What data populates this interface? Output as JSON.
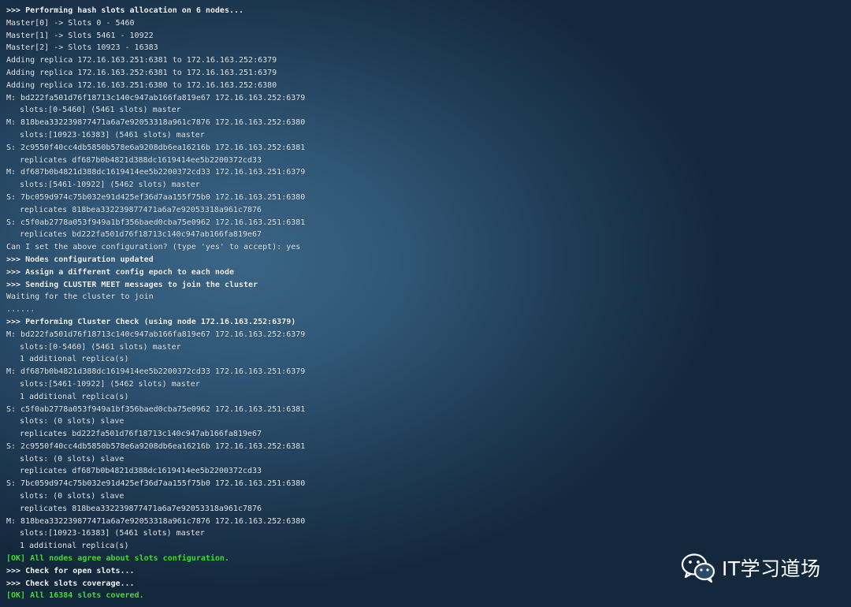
{
  "terminal": {
    "lines": [
      {
        "text": ">>> Performing hash slots allocation on 6 nodes...",
        "style": "bold"
      },
      {
        "text": "Master[0] -> Slots 0 - 5460",
        "style": "normal"
      },
      {
        "text": "Master[1] -> Slots 5461 - 10922",
        "style": "normal"
      },
      {
        "text": "Master[2] -> Slots 10923 - 16383",
        "style": "normal"
      },
      {
        "text": "Adding replica 172.16.163.251:6381 to 172.16.163.252:6379",
        "style": "normal"
      },
      {
        "text": "Adding replica 172.16.163.252:6381 to 172.16.163.251:6379",
        "style": "normal"
      },
      {
        "text": "Adding replica 172.16.163.251:6380 to 172.16.163.252:6380",
        "style": "normal"
      },
      {
        "text": "M: bd222fa501d76f18713c140c947ab166fa819e67 172.16.163.252:6379",
        "style": "normal"
      },
      {
        "text": "slots:[0-5460] (5461 slots) master",
        "style": "indent"
      },
      {
        "text": "M: 818bea332239877471a6a7e92053318a961c7876 172.16.163.252:6380",
        "style": "normal"
      },
      {
        "text": "slots:[10923-16383] (5461 slots) master",
        "style": "indent"
      },
      {
        "text": "S: 2c9550f40cc4db5850b578e6a9208db6ea16216b 172.16.163.252:6381",
        "style": "normal"
      },
      {
        "text": "replicates df687b0b4821d388dc1619414ee5b2200372cd33",
        "style": "indent"
      },
      {
        "text": "M: df687b0b4821d388dc1619414ee5b2200372cd33 172.16.163.251:6379",
        "style": "normal"
      },
      {
        "text": "slots:[5461-10922] (5462 slots) master",
        "style": "indent"
      },
      {
        "text": "S: 7bc059d974c75b032e91d425ef36d7aa155f75b0 172.16.163.251:6380",
        "style": "normal"
      },
      {
        "text": "replicates 818bea332239877471a6a7e92053318a961c7876",
        "style": "indent"
      },
      {
        "text": "S: c5f0ab2778a053f949a1bf356baed0cba75e0962 172.16.163.251:6381",
        "style": "normal"
      },
      {
        "text": "replicates bd222fa501d76f18713c140c947ab166fa819e67",
        "style": "indent"
      },
      {
        "text": "Can I set the above configuration? (type 'yes' to accept): yes",
        "style": "normal"
      },
      {
        "text": ">>> Nodes configuration updated",
        "style": "bold"
      },
      {
        "text": ">>> Assign a different config epoch to each node",
        "style": "bold"
      },
      {
        "text": ">>> Sending CLUSTER MEET messages to join the cluster",
        "style": "bold"
      },
      {
        "text": "Waiting for the cluster to join",
        "style": "normal"
      },
      {
        "text": "......",
        "style": "normal"
      },
      {
        "text": ">>> Performing Cluster Check (using node 172.16.163.252:6379)",
        "style": "bold"
      },
      {
        "text": "M: bd222fa501d76f18713c140c947ab166fa819e67 172.16.163.252:6379",
        "style": "normal"
      },
      {
        "text": "slots:[0-5460] (5461 slots) master",
        "style": "indent"
      },
      {
        "text": "1 additional replica(s)",
        "style": "indent"
      },
      {
        "text": "M: df687b0b4821d388dc1619414ee5b2200372cd33 172.16.163.251:6379",
        "style": "normal"
      },
      {
        "text": "slots:[5461-10922] (5462 slots) master",
        "style": "indent"
      },
      {
        "text": "1 additional replica(s)",
        "style": "indent"
      },
      {
        "text": "S: c5f0ab2778a053f949a1bf356baed0cba75e0962 172.16.163.251:6381",
        "style": "normal"
      },
      {
        "text": "slots: (0 slots) slave",
        "style": "indent"
      },
      {
        "text": "replicates bd222fa501d76f18713c140c947ab166fa819e67",
        "style": "indent"
      },
      {
        "text": "S: 2c9550f40cc4db5850b578e6a9208db6ea16216b 172.16.163.252:6381",
        "style": "normal"
      },
      {
        "text": "slots: (0 slots) slave",
        "style": "indent"
      },
      {
        "text": "replicates df687b0b4821d388dc1619414ee5b2200372cd33",
        "style": "indent"
      },
      {
        "text": "S: 7bc059d974c75b032e91d425ef36d7aa155f75b0 172.16.163.251:6380",
        "style": "normal"
      },
      {
        "text": "slots: (0 slots) slave",
        "style": "indent"
      },
      {
        "text": "replicates 818bea332239877471a6a7e92053318a961c7876",
        "style": "indent"
      },
      {
        "text": "M: 818bea332239877471a6a7e92053318a961c7876 172.16.163.252:6380",
        "style": "normal"
      },
      {
        "text": "slots:[10923-16383] (5461 slots) master",
        "style": "indent"
      },
      {
        "text": "1 additional replica(s)",
        "style": "indent"
      },
      {
        "text": "[OK] All nodes agree about slots configuration.",
        "style": "ok"
      },
      {
        "text": ">>> Check for open slots...",
        "style": "bold"
      },
      {
        "text": ">>> Check slots coverage...",
        "style": "bold"
      },
      {
        "text": "[OK] All 16384 slots covered.",
        "style": "ok"
      }
    ]
  },
  "watermark": {
    "icon": "wechat-icon",
    "text": "IT学习道场"
  },
  "colors": {
    "text": "#e6ecf2",
    "ok": "#3fe03a",
    "background": "#2f5675"
  }
}
